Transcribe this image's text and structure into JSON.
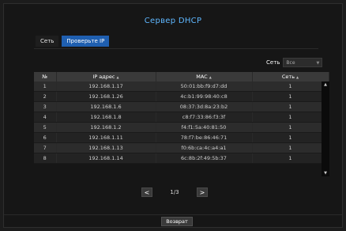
{
  "window": {
    "title": "Сервер DHCP"
  },
  "tabs": [
    {
      "label": "Сеть",
      "active": false
    },
    {
      "label": "Проверьте IP",
      "active": true
    }
  ],
  "filter": {
    "label": "Сеть",
    "value": "Все"
  },
  "table": {
    "columns": [
      "№",
      "IP адрес",
      "MAC",
      "Сеть"
    ],
    "rows": [
      [
        "1",
        "192.168.1.17",
        "50:01:bb:f9:d7:dd",
        "1"
      ],
      [
        "2",
        "192.168.1.26",
        "4c:b1:99:98:40:c8",
        "1"
      ],
      [
        "3",
        "192.168.1.6",
        "08:37:3d:8a:23:b2",
        "1"
      ],
      [
        "4",
        "192.168.1.8",
        "c8:f7:33:86:f3:3f",
        "1"
      ],
      [
        "5",
        "192.168.1.2",
        "f4:f1:5a:40:81:50",
        "1"
      ],
      [
        "6",
        "192.168.1.11",
        "78:f7:be:86:46:71",
        "1"
      ],
      [
        "7",
        "192.168.1.13",
        "f0:6b:ca:4c:a4:a1",
        "1"
      ],
      [
        "8",
        "192.168.1.14",
        "6c:8b:2f:49:5b:37",
        "1"
      ]
    ]
  },
  "pagination": {
    "current": "1/3",
    "prev_icon": "<",
    "next_icon": ">"
  },
  "footer": {
    "back_label": "Возврат"
  }
}
